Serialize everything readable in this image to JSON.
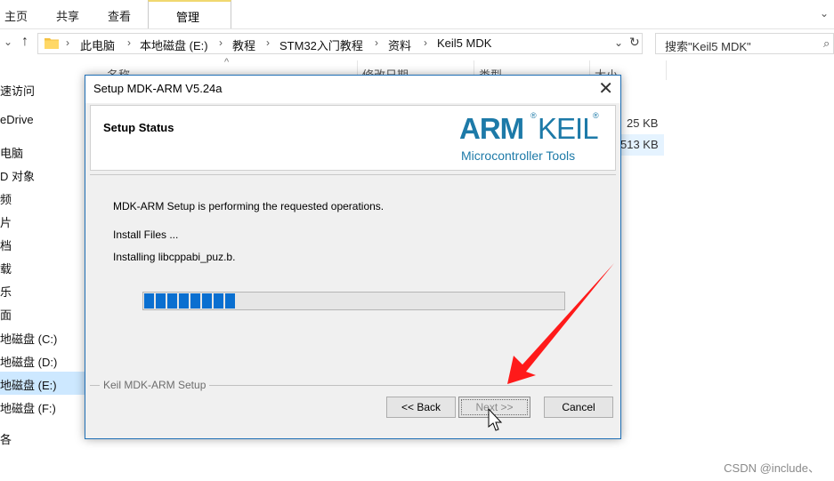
{
  "ribbon": {
    "tabs": [
      "主页",
      "共享",
      "查看"
    ],
    "manage_tab": "管理"
  },
  "address": {
    "up_arrow": "↑",
    "crumbs": [
      "此电脑",
      "本地磁盘 (E:)",
      "教程",
      "STM32入门教程",
      "资料",
      "Keil5 MDK"
    ],
    "search_placeholder": "搜索\"Keil5 MDK\""
  },
  "sidebar": {
    "items": [
      "速访问",
      "eDrive",
      "电脑",
      "D 对象",
      "频",
      "片",
      "档",
      "载",
      "乐",
      "面",
      "地磁盘 (C:)",
      "地磁盘 (D:)",
      "地磁盘 (E:)",
      "地磁盘 (F:)",
      "各"
    ]
  },
  "columns": {
    "name": "名称",
    "date": "修改日期",
    "type": "类型",
    "size": "大小"
  },
  "files": {
    "sizes": [
      "25 KB",
      "513 KB"
    ]
  },
  "dialog": {
    "title": "Setup MDK-ARM V5.24a",
    "header_title": "Setup Status",
    "logo_arm": "ARM",
    "logo_keil": "KEIL",
    "logo_sub": "Microcontroller Tools",
    "status_line": "MDK-ARM Setup is performing the requested operations.",
    "action_line": "Install Files ...",
    "file_line": "Installing libcppabi_puz.b.",
    "progress_percent": 22,
    "group_label": "Keil MDK-ARM Setup",
    "buttons": {
      "back": "<< Back",
      "next": "Next >>",
      "cancel": "Cancel"
    }
  },
  "colors": {
    "dialog_border": "#1f6fb5",
    "progress_fill": "#0a6fd0",
    "logo_blue": "#1d7aa8",
    "arrow_red": "#ff1a1a"
  },
  "watermark": "CSDN @include、"
}
